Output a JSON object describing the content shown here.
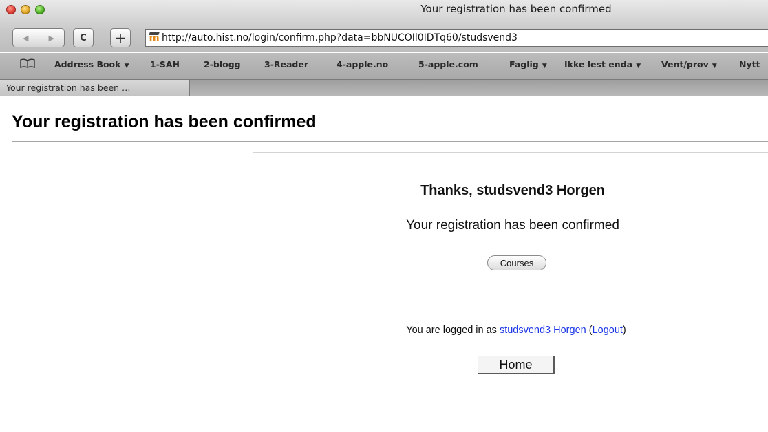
{
  "window": {
    "title": "Your registration has been confirmed"
  },
  "toolbar": {
    "back_icon": "◀",
    "forward_icon": "▶",
    "reload_icon": "C",
    "add_bookmark_icon": "+",
    "url": "http://auto.hist.no/login/confirm.php?data=bbNUCOIl0IDTq60/studsvend3"
  },
  "bookmarks": {
    "items": [
      {
        "label": "Address Book",
        "has_menu": true
      },
      {
        "label": "1-SAH",
        "has_menu": false
      },
      {
        "label": "2-blogg",
        "has_menu": false
      },
      {
        "label": "3-Reader",
        "has_menu": false
      },
      {
        "label": "4-apple.no",
        "has_menu": false
      },
      {
        "label": "5-apple.com",
        "has_menu": false
      },
      {
        "label": "Faglig",
        "has_menu": true
      },
      {
        "label": "Ikke lest enda",
        "has_menu": true
      },
      {
        "label": "Vent/prøv",
        "has_menu": true
      },
      {
        "label": "Nytt",
        "has_menu": false
      }
    ]
  },
  "tabs": [
    {
      "label": "Your registration has been …",
      "active": true
    }
  ],
  "page": {
    "heading": "Your registration has been confirmed",
    "box": {
      "thanks": "Thanks, studsvend3 Horgen",
      "message": "Your registration has been confirmed",
      "courses_button": "Courses"
    },
    "login_info": {
      "prefix": "You are logged in as ",
      "user_link": "studsvend3 Horgen",
      "open_paren": " (",
      "logout_link": "Logout",
      "close_paren": ")"
    },
    "home_button": "Home"
  }
}
